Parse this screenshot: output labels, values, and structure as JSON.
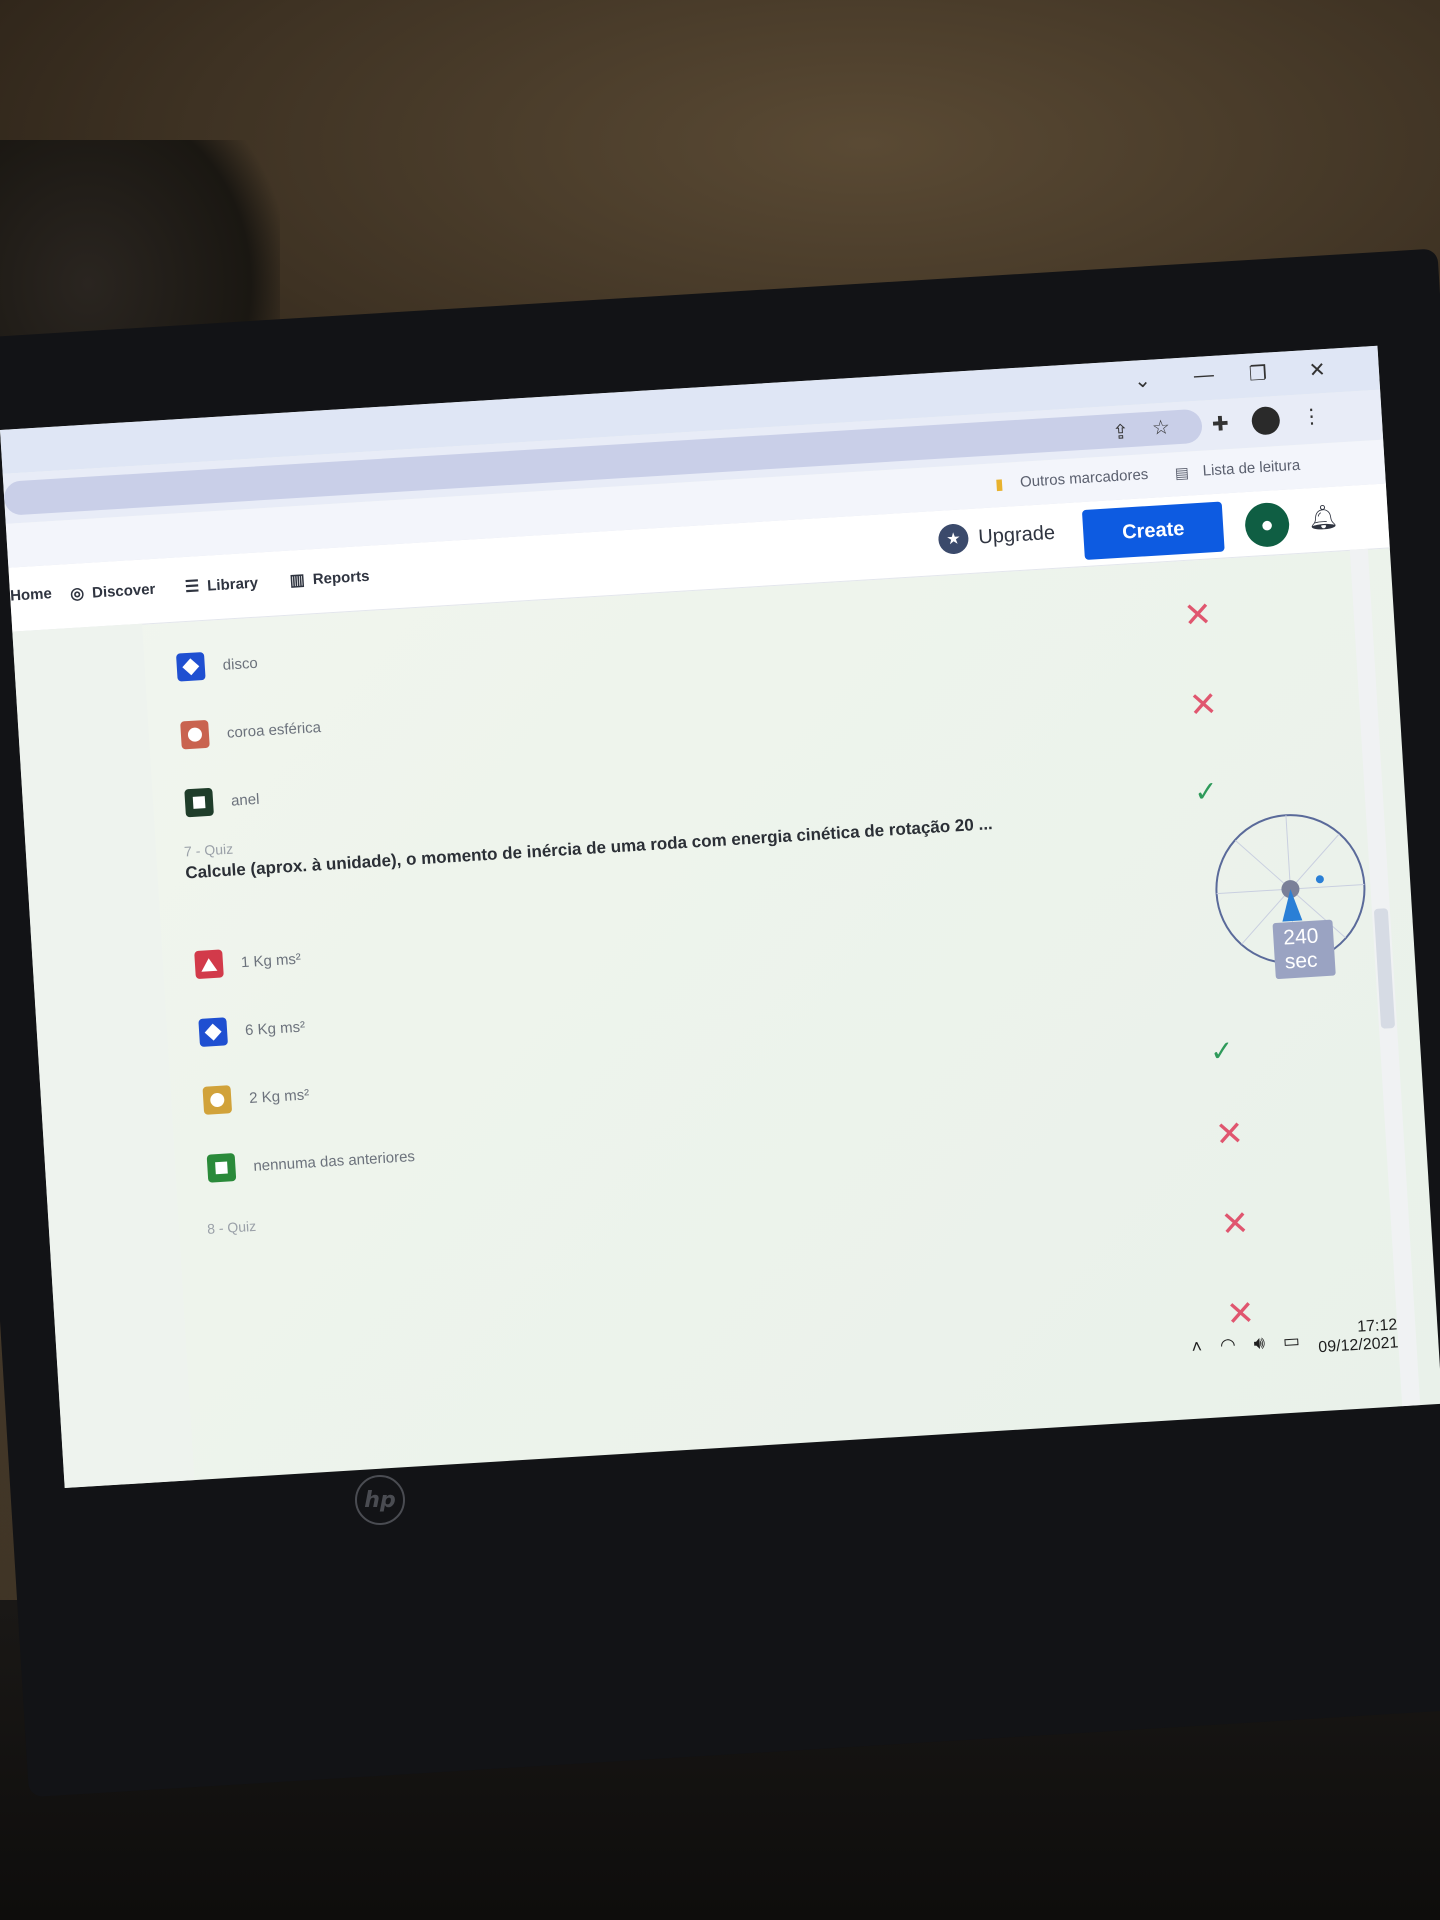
{
  "browser": {
    "bookmarks_other": "Outros marcadores",
    "reading_list": "Lista de leitura"
  },
  "nav": {
    "home": "Home",
    "discover": "Discover",
    "library": "Library",
    "reports": "Reports",
    "upgrade": "Upgrade",
    "create": "Create"
  },
  "prev_answers": [
    {
      "label": "disco",
      "shape": "diamond",
      "color": "#1f4fd1"
    },
    {
      "label": "coroa esférica",
      "shape": "circle",
      "color": "#c9634f"
    },
    {
      "label": "anel",
      "shape": "square",
      "color": "#1f3d2a"
    }
  ],
  "quiz7": {
    "label": "7 - Quiz",
    "question": "Calcule (aprox. à unidade), o momento de inércia de uma roda com energia cinética de rotação 20 ...",
    "answers": [
      {
        "label": "1 Kg ms²",
        "shape": "triangle",
        "color": "#d23a4a"
      },
      {
        "label": "6 Kg ms²",
        "shape": "diamond",
        "color": "#1f4fd1"
      },
      {
        "label": "2 Kg ms²",
        "shape": "circle",
        "color": "#d1a23a"
      },
      {
        "label": "nennuma das anteriores",
        "shape": "square",
        "color": "#2a8a3a"
      }
    ],
    "timer": "240 sec"
  },
  "quiz8": {
    "label": "8 - Quiz"
  },
  "taskbar": {
    "time": "17:12",
    "date": "09/12/2021"
  },
  "colors": {
    "accent": "#0d5be1",
    "correct": "#2e9a5a",
    "wrong": "#e0566f"
  }
}
